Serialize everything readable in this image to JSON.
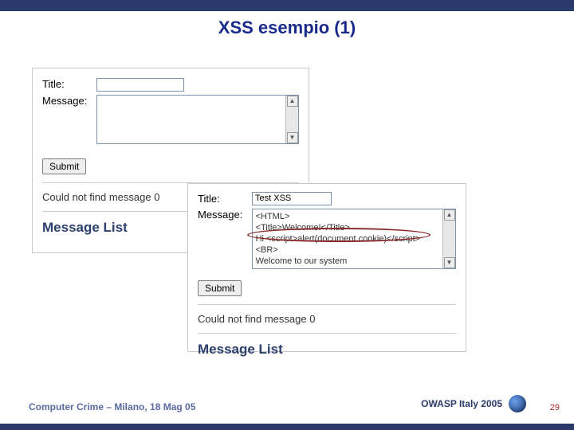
{
  "slide": {
    "title": "XSS esempio (1)"
  },
  "panelA": {
    "title_label": "Title:",
    "message_label": "Message:",
    "submit": "Submit",
    "error": "Could not find message 0",
    "list_heading": "Message List"
  },
  "panelB": {
    "title_label": "Title:",
    "title_value": "Test XSS",
    "message_label": "Message:",
    "message_lines": {
      "l1": "<HTML>",
      "l2": "<Title>Welcome!</Title>",
      "l3": "Hi <script>alert(document.cookie)</script>",
      "l4": "<BR>",
      "l5": "Welcome to our system"
    },
    "submit": "Submit",
    "error": "Could not find message 0",
    "list_heading": "Message List"
  },
  "footer": {
    "left": "Computer Crime – Milano, 18 Mag 05",
    "right": "OWASP Italy 2005",
    "page": "29"
  }
}
